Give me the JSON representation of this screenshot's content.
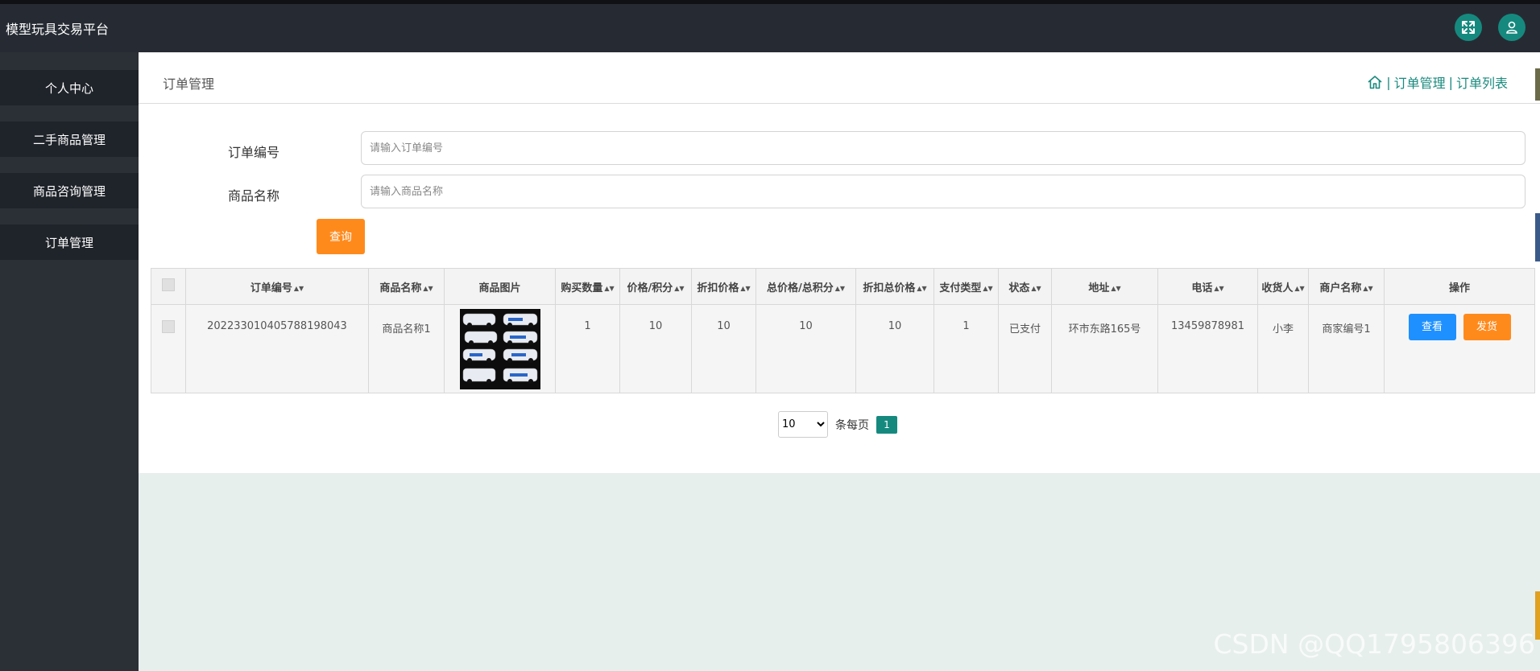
{
  "app": {
    "title": "模型玩具交易平台"
  },
  "sidebar": {
    "items": [
      {
        "label": "个人中心"
      },
      {
        "label": "二手商品管理"
      },
      {
        "label": "商品咨询管理"
      },
      {
        "label": "订单管理"
      }
    ]
  },
  "panel": {
    "title": "订单管理",
    "breadcrumb": {
      "sep": "|",
      "level1": "订单管理",
      "level2": "订单列表"
    }
  },
  "search": {
    "order_no": {
      "label": "订单编号",
      "placeholder": "请输入订单编号",
      "value": ""
    },
    "product_name": {
      "label": "商品名称",
      "placeholder": "请输入商品名称",
      "value": ""
    },
    "query_label": "查询"
  },
  "table": {
    "headers": [
      "订单编号",
      "商品名称",
      "商品图片",
      "购买数量",
      "价格/积分",
      "折扣价格",
      "总价格/总积分",
      "折扣总价格",
      "支付类型",
      "状态",
      "地址",
      "电话",
      "收货人",
      "商户名称",
      "操作"
    ],
    "rows": [
      {
        "order_no": "202233010405788198043",
        "product_name": "商品名称1",
        "quantity": "1",
        "price": "10",
        "discount_price": "10",
        "total": "10",
        "discount_total": "10",
        "pay_type": "1",
        "status": "已支付",
        "address": "环市东路165号",
        "phone": "13459878981",
        "receiver": "小李",
        "merchant": "商家编号1",
        "view_label": "查看",
        "ship_label": "发货"
      }
    ]
  },
  "pagination": {
    "page_size": "10",
    "per_page_label": "条每页",
    "current_page": "1"
  },
  "watermark": "CSDN @QQ1795806396",
  "colors": {
    "topbar": "#262b33",
    "accent_teal": "#16897f",
    "orange": "#ff8a1c",
    "blue": "#1e90ff"
  }
}
